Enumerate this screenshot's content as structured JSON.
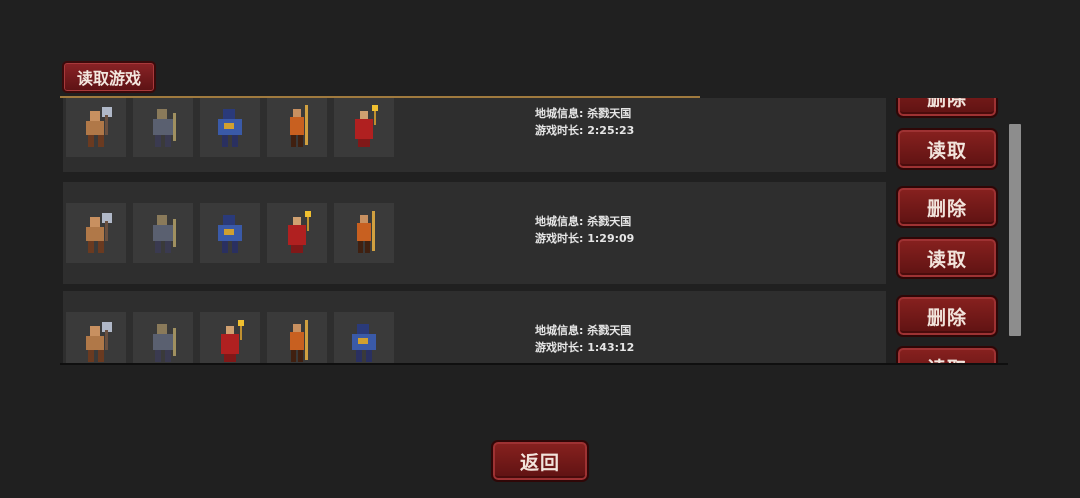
{
  "header": {
    "title": "读取游戏"
  },
  "slots": [
    {
      "dungeon_label": "地城信息:",
      "dungeon_value": "杀戮天国",
      "time_label": "游戏时长:",
      "time_value": "2:25:23",
      "heroes": [
        "axe-warrior-sprite",
        "armored-knight-sprite",
        "blue-golem-sprite",
        "staff-monk-sprite",
        "red-mage-sprite"
      ]
    },
    {
      "dungeon_label": "地城信息:",
      "dungeon_value": "杀戮天国",
      "time_label": "游戏时长:",
      "time_value": "1:29:09",
      "heroes": [
        "axe-warrior-sprite",
        "armored-knight-sprite",
        "blue-golem-sprite",
        "red-mage-sprite",
        "staff-monk-sprite"
      ]
    },
    {
      "dungeon_label": "地城信息:",
      "dungeon_value": "杀戮天国",
      "time_label": "游戏时长:",
      "time_value": "1:43:12",
      "heroes": [
        "axe-warrior-sprite",
        "armored-knight-sprite",
        "red-mage-sprite",
        "staff-monk-sprite",
        "blue-golem-sprite"
      ]
    }
  ],
  "buttons": {
    "delete": "删除",
    "load": "读取",
    "back": "返回"
  },
  "colors": {
    "button_red": "#7a1c1c",
    "panel": "#2e2e2e",
    "background": "#202020",
    "accent_gold": "#a07a3e"
  }
}
